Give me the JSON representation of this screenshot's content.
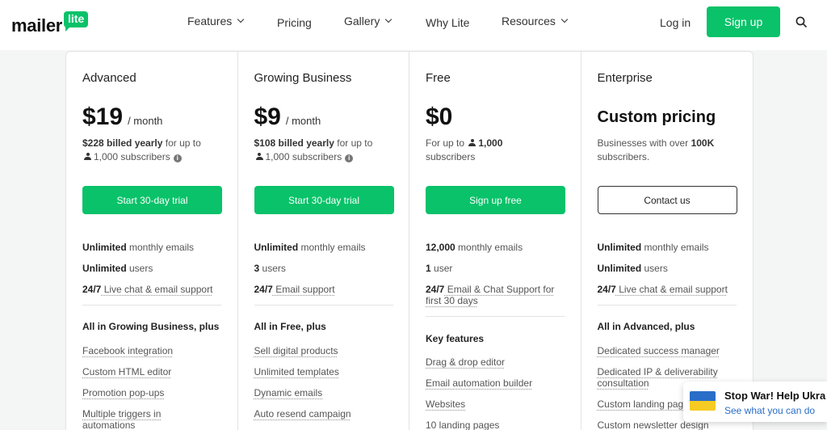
{
  "header": {
    "logo_text": "mailer",
    "logo_badge": "lite",
    "nav": [
      {
        "label": "Features",
        "dropdown": true
      },
      {
        "label": "Pricing",
        "dropdown": false
      },
      {
        "label": "Gallery",
        "dropdown": true
      },
      {
        "label": "Why Lite",
        "dropdown": false
      },
      {
        "label": "Resources",
        "dropdown": true
      }
    ],
    "login": "Log in",
    "signup": "Sign up"
  },
  "colors": {
    "accent": "#09c269",
    "border": "#e3e3e3",
    "link_blue": "#2a6ec8",
    "flag_blue": "#2a6ec8",
    "flag_yellow": "#f6cb23"
  },
  "plans": [
    {
      "name": "Advanced",
      "price": "$19",
      "period": "/ month",
      "billing_bold": "$228 billed yearly",
      "billing_rest": " for up to",
      "subscribers": "1,000 subscribers",
      "cta": "Start 30-day trial",
      "features": [
        {
          "bold": "Unlimited",
          "rest": " monthly emails"
        },
        {
          "bold": "Unlimited",
          "rest": " users"
        },
        {
          "bold": "24/7",
          "rest": " Live chat & email support"
        }
      ],
      "section_title": "All in Growing Business, plus",
      "extras": [
        "Facebook integration",
        "Custom HTML editor",
        "Promotion pop-ups",
        "Multiple triggers in automations"
      ]
    },
    {
      "name": "Growing Business",
      "price": "$9",
      "period": "/ month",
      "billing_bold": "$108 billed yearly",
      "billing_rest": " for up to",
      "subscribers": "1,000 subscribers",
      "cta": "Start 30-day trial",
      "features": [
        {
          "bold": "Unlimited",
          "rest": " monthly emails"
        },
        {
          "bold": "3",
          "rest": " users"
        },
        {
          "bold": "24/7",
          "rest": " Email support"
        }
      ],
      "section_title": "All in Free, plus",
      "extras": [
        "Sell digital products",
        "Unlimited templates",
        "Dynamic emails",
        "Auto resend campaign"
      ]
    },
    {
      "name": "Free",
      "price": "$0",
      "billing_pre": "For up to",
      "subscribers_count": "1,000",
      "subscribers_word": "subscribers",
      "cta": "Sign up free",
      "features": [
        {
          "bold": "12,000",
          "rest": " monthly emails"
        },
        {
          "bold": "1",
          "rest": " user"
        },
        {
          "bold": "24/7",
          "rest": " Email & Chat Support for first 30 days"
        }
      ],
      "section_title": "Key features",
      "extras": [
        "Drag & drop editor",
        "Email automation builder",
        "Websites",
        "10 landing pages"
      ]
    },
    {
      "name": "Enterprise",
      "price": "Custom pricing",
      "billing_pre": "Businesses with over",
      "billing_bold": "100K",
      "billing_post": "subscribers.",
      "cta": "Contact us",
      "features": [
        {
          "bold": "Unlimited",
          "rest": " monthly emails"
        },
        {
          "bold": "Unlimited",
          "rest": " users"
        },
        {
          "bold": "24/7",
          "rest": " Live chat & email support"
        }
      ],
      "section_title": "All in Advanced, plus",
      "extras": [
        "Dedicated success manager",
        "Dedicated IP & deliverability consultation",
        "Custom landing pag",
        "Custom newsletter design"
      ]
    }
  ],
  "banner": {
    "title": "Stop War! Help Ukra",
    "link": "See what you can do"
  }
}
